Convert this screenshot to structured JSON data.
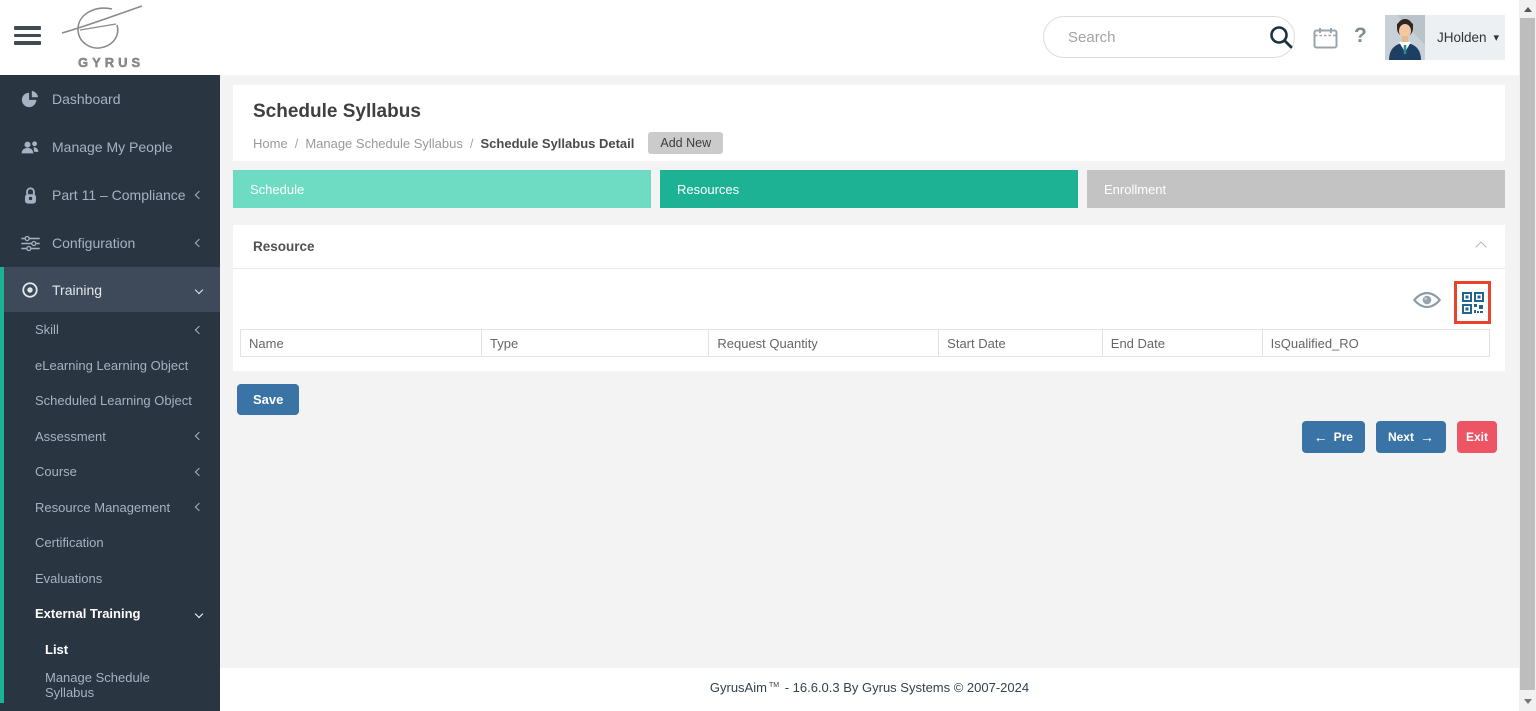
{
  "header": {
    "logo_text": "GYRUS",
    "search_placeholder": "Search",
    "username": "JHolden",
    "caret_glyph": "▾",
    "help_glyph": "?"
  },
  "sidebar": {
    "items": [
      {
        "label": "Dashboard",
        "icon": "pie-chart-icon"
      },
      {
        "label": "Manage My People",
        "icon": "people-icon"
      },
      {
        "label": "Part 11 – Compliance",
        "icon": "lock-icon",
        "chevron": "left"
      },
      {
        "label": "Configuration",
        "icon": "sliders-icon",
        "chevron": "left"
      },
      {
        "label": "Training",
        "icon": "target-icon",
        "chevron": "down",
        "active": true
      }
    ],
    "training_items": [
      {
        "label": "Skill",
        "chevron": "left"
      },
      {
        "label": "eLearning Learning Object"
      },
      {
        "label": "Scheduled Learning Object"
      },
      {
        "label": "Assessment",
        "chevron": "left"
      },
      {
        "label": "Course",
        "chevron": "left"
      },
      {
        "label": "Resource Management",
        "chevron": "left"
      },
      {
        "label": "Certification"
      },
      {
        "label": "Evaluations"
      },
      {
        "label": "External Training",
        "chevron": "down",
        "bold": true
      }
    ],
    "external_training_items": [
      {
        "label": "List",
        "bold": true
      },
      {
        "label": "Manage Schedule Syllabus"
      }
    ]
  },
  "page": {
    "title": "Schedule Syllabus",
    "breadcrumb": [
      "Home",
      "Manage Schedule Syllabus",
      "Schedule Syllabus Detail"
    ],
    "breadcrumb_separator": "/",
    "add_new_label": "Add New"
  },
  "tabs": [
    {
      "label": "Schedule",
      "color": "#6edcc3",
      "state": "visited"
    },
    {
      "label": "Resources",
      "color": "#1cb293",
      "state": "active"
    },
    {
      "label": "Enrollment",
      "color": "#c3c3c3",
      "state": "inactive"
    }
  ],
  "resource_panel": {
    "title": "Resource",
    "icons": [
      "eye-icon",
      "qr-code-icon"
    ],
    "qr_highlight_color": "#e8432c",
    "table_headers": [
      "Name",
      "Type",
      "Request Quantity",
      "Start Date",
      "End Date",
      "IsQualified_RO"
    ]
  },
  "actions": {
    "save": "Save",
    "pre": "Pre",
    "pre_arrow": "←",
    "next": "Next",
    "next_arrow": "→",
    "exit": "Exit"
  },
  "footer": {
    "product": "GyrusAim",
    "trademark": "TM",
    "version_text": "- 16.6.0.3 By Gyrus Systems © 2007-2024"
  },
  "colors": {
    "sidebar_bg": "#2a3542",
    "sidebar_active_bg": "#3e4a59",
    "accent_teal": "#1ab394",
    "button_blue": "#3a74a6",
    "button_red": "#ed5565",
    "qr_highlight_red": "#e8432c"
  }
}
